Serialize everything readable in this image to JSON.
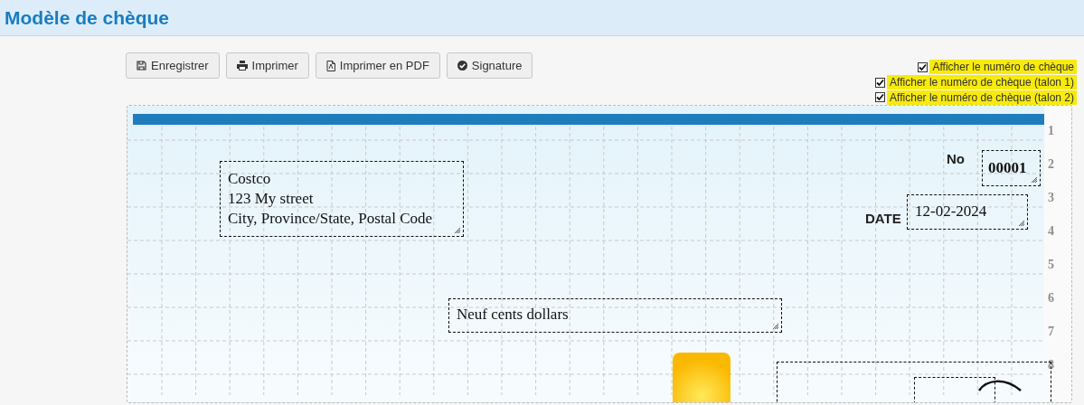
{
  "title": "Modèle de chèque",
  "buttons": [
    {
      "label": "Enregistrer",
      "kind": "save"
    },
    {
      "label": "Imprimer",
      "kind": "print"
    },
    {
      "label": "Imprimer en PDF",
      "kind": "pdf"
    },
    {
      "label": "Signature",
      "kind": "signature"
    }
  ],
  "options": [
    {
      "label": "Afficher le numéro de chèque",
      "checked": true
    },
    {
      "label": "Afficher le numéro de chèque (talon 1)",
      "checked": true
    },
    {
      "label": "Afficher le numéro de chèque (talon 2)",
      "checked": true
    }
  ],
  "cheque": {
    "address_lines": [
      "Costco",
      "123 My street",
      "City, Province/State, Postal Code"
    ],
    "number_label": "No",
    "number": "00001",
    "date_label": "DATE",
    "date": "12-02-2024",
    "amount_words": "Neuf cents dollars",
    "row_numbers": [
      "1",
      "2",
      "3",
      "4",
      "5",
      "6",
      "7",
      "8"
    ]
  }
}
